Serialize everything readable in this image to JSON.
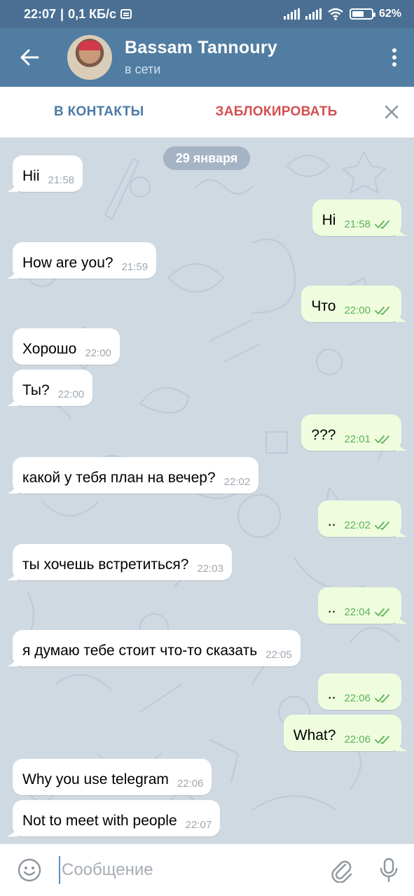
{
  "status_bar": {
    "time": "22:07",
    "net_speed": "0,1 КБ/с",
    "battery": "62%",
    "battery_level": 0.62
  },
  "header": {
    "contact_name": "Bassam Tannoury",
    "presence": "в сети"
  },
  "actions": {
    "add_contact": "В КОНТАКТЫ",
    "block": "ЗАБЛОКИРОВАТЬ"
  },
  "chat": {
    "date": "29 января",
    "messages": [
      {
        "direction": "in",
        "text": "Hii",
        "time": "21:58"
      },
      {
        "direction": "out",
        "text": "Hi",
        "time": "21:58"
      },
      {
        "direction": "in",
        "text": "How are you?",
        "time": "21:59"
      },
      {
        "direction": "out",
        "text": "Что",
        "time": "22:00"
      },
      {
        "direction": "in",
        "text": "Хорошо",
        "time": "22:00"
      },
      {
        "direction": "in",
        "text": "Ты?",
        "time": "22:00"
      },
      {
        "direction": "out",
        "text": "???",
        "time": "22:01"
      },
      {
        "direction": "in",
        "text": "какой у тебя план на вечер?",
        "time": "22:02"
      },
      {
        "direction": "out",
        "text": "..",
        "time": "22:02"
      },
      {
        "direction": "in",
        "text": "ты хочешь встретиться?",
        "time": "22:03"
      },
      {
        "direction": "out",
        "text": "..",
        "time": "22:04"
      },
      {
        "direction": "in",
        "text": "я думаю тебе стоит что-то сказать",
        "time": "22:05"
      },
      {
        "direction": "out",
        "text": "..",
        "time": "22:06"
      },
      {
        "direction": "out",
        "text": "What?",
        "time": "22:06"
      },
      {
        "direction": "in",
        "text": "Why you use telegram",
        "time": "22:06"
      },
      {
        "direction": "in",
        "text": "Not to meet with people",
        "time": "22:07"
      }
    ]
  },
  "composer": {
    "placeholder": "Сообщение"
  },
  "colors": {
    "header": "#517da2",
    "status_bar": "#4a6f93",
    "chat_bg": "#cfd9e2",
    "incoming_bubble": "#ffffff",
    "outgoing_bubble": "#effdde",
    "read_check": "#5cb25a",
    "block_red": "#d35050",
    "add_blue": "#4c7aa5"
  }
}
